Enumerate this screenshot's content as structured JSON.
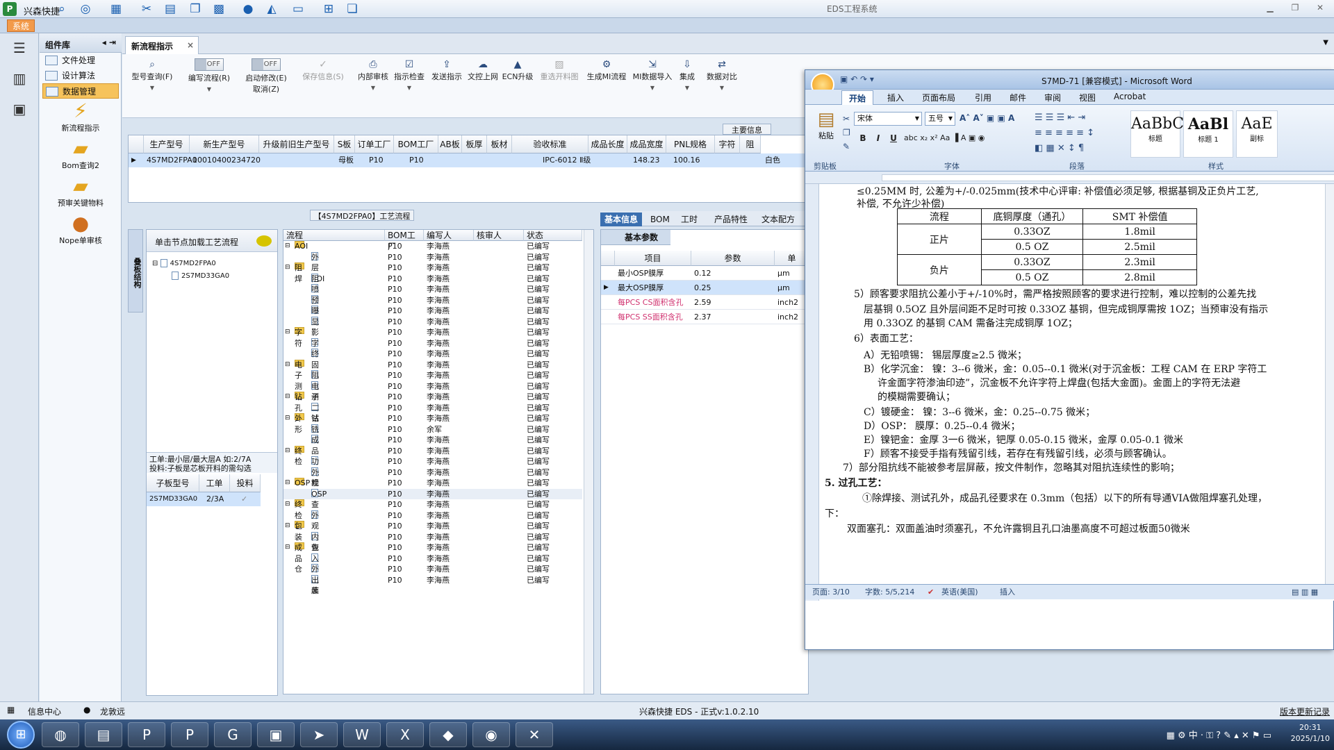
{
  "app": {
    "name": "兴森快捷",
    "window_title": "EDS工程系统",
    "sys_tab": "系统"
  },
  "sidebar": {
    "header": "组件库",
    "items": [
      "文件处理",
      "设计算法",
      "数据管理"
    ],
    "big_icons": [
      "新流程指示",
      "Bom查询2",
      "预审关键物料",
      "Nope单审核"
    ]
  },
  "main_tab": {
    "label": "新流程指示",
    "close": "×"
  },
  "ribbon": [
    {
      "label": "型号查询(F)",
      "icon": "search-icon",
      "enabled": true
    },
    {
      "label": "编写流程(R)",
      "toggle": "OFF",
      "enabled": true
    },
    {
      "label": "启动修改(E)",
      "sub": "取消(Z)",
      "toggle": "OFF",
      "enabled": true
    },
    {
      "label": "保存信息(S)",
      "icon": "check-icon",
      "enabled": false
    },
    {
      "label": "内部审核",
      "icon": "print-icon",
      "enabled": true
    },
    {
      "label": "指示检查",
      "icon": "checklist-icon",
      "enabled": true
    },
    {
      "label": "发送指示",
      "icon": "upload-icon",
      "enabled": true
    },
    {
      "label": "文控上网",
      "icon": "cloud-upload-icon",
      "enabled": true
    },
    {
      "label": "ECN升级",
      "icon": "triangle-icon",
      "enabled": true
    },
    {
      "label": "重选开料图",
      "icon": "image-icon",
      "enabled": false
    },
    {
      "label": "生成MI流程",
      "icon": "cogs-icon",
      "enabled": true
    },
    {
      "label": "MI数据导入",
      "icon": "import-icon",
      "enabled": true
    },
    {
      "label": "集成",
      "icon": "download-icon",
      "enabled": true
    },
    {
      "label": "数据对比",
      "icon": "compare-icon",
      "enabled": true
    }
  ],
  "main_grid": {
    "title": "主要信息",
    "columns": [
      "生产型号",
      "新生产型号",
      "升级前旧生产型号",
      "S板",
      "订单工厂",
      "BOM工厂",
      "AB板",
      "板厚",
      "板材",
      "验收标准",
      "成品长度",
      "成品宽度",
      "PNL规格",
      "字符",
      "阻"
    ],
    "rows": [
      [
        "4S7MD2FPA0",
        "10010400234720",
        "",
        "母板",
        "P10",
        "P10",
        "",
        "",
        "",
        "IPC-6012 Ⅱ级",
        "148.23",
        "100.16",
        "",
        "白色",
        ""
      ]
    ]
  },
  "tree_panel": {
    "title": "【4S7MD2FPA0】工艺流程",
    "vertical_tab": "叠板结构",
    "load_hint": "单击节点加载工艺流程",
    "nodes": [
      "4S7MD2FPA0",
      "2S7MD33GA0"
    ],
    "info": "工单:最小层/最大层A 如:2/7A\n投料:子板是芯板开料的需勾选",
    "sub_columns": [
      "子板型号",
      "工单",
      "投料"
    ],
    "sub_row": [
      "2S7MD33GA0",
      "2/3A",
      "✓"
    ]
  },
  "process": {
    "columns": [
      "流程",
      "BOM工厂",
      "编写人",
      "核审人",
      "状态"
    ],
    "rows": [
      {
        "name": "AOI",
        "type": "folder",
        "factory": "P10",
        "writer": "李海燕",
        "status": "已编写"
      },
      {
        "name": "外层AOI",
        "type": "doc",
        "factory": "P10",
        "writer": "李海燕",
        "status": "已编写"
      },
      {
        "name": "阻焊",
        "type": "folder",
        "factory": "P10",
        "writer": "李海燕",
        "status": "已编写"
      },
      {
        "name": "阻焊前处理",
        "type": "doc",
        "factory": "P10",
        "writer": "李海燕",
        "status": "已编写"
      },
      {
        "name": "喷涂",
        "type": "doc",
        "factory": "P10",
        "writer": "李海燕",
        "status": "已编写"
      },
      {
        "name": "预烘",
        "type": "doc",
        "factory": "P10",
        "writer": "李海燕",
        "status": "已编写"
      },
      {
        "name": "曝光",
        "type": "doc",
        "factory": "P10",
        "writer": "李海燕",
        "status": "已编写"
      },
      {
        "name": "显影",
        "type": "doc",
        "factory": "P10",
        "writer": "李海燕",
        "status": "已编写"
      },
      {
        "name": "字符",
        "type": "folder",
        "factory": "P10",
        "writer": "李海燕",
        "status": "已编写"
      },
      {
        "name": "字符",
        "type": "doc",
        "factory": "P10",
        "writer": "李海燕",
        "status": "已编写"
      },
      {
        "name": "终固化",
        "type": "doc",
        "factory": "P10",
        "writer": "李海燕",
        "status": "已编写"
      },
      {
        "name": "电子测试",
        "type": "folder",
        "factory": "P10",
        "writer": "李海燕",
        "status": "已编写"
      },
      {
        "name": "阻抗测试",
        "type": "doc",
        "factory": "P10",
        "writer": "李海燕",
        "status": "已编写"
      },
      {
        "name": "电子测试",
        "type": "doc",
        "factory": "P10",
        "writer": "李海燕",
        "status": "已编写"
      },
      {
        "name": "钻孔1",
        "type": "folder",
        "factory": "P10",
        "writer": "李海燕",
        "status": "已编写"
      },
      {
        "name": "二钻",
        "type": "doc",
        "factory": "P10",
        "writer": "李海燕",
        "status": "已编写"
      },
      {
        "name": "外形",
        "type": "folder",
        "factory": "P10",
        "writer": "李海燕",
        "status": "已编写"
      },
      {
        "name": "铣板",
        "type": "doc",
        "factory": "P10",
        "writer": "余军",
        "status": "已编写"
      },
      {
        "name": "成品清洗",
        "type": "doc",
        "factory": "P10",
        "writer": "李海燕",
        "status": "已编写"
      },
      {
        "name": "终检",
        "type": "folder",
        "factory": "P10",
        "writer": "李海燕",
        "status": "已编写"
      },
      {
        "name": "功能检查",
        "type": "doc",
        "factory": "P10",
        "writer": "李海燕",
        "status": "已编写"
      },
      {
        "name": "外观检查",
        "type": "doc",
        "factory": "P10",
        "writer": "李海燕",
        "status": "已编写"
      },
      {
        "name": "OSP",
        "type": "folder",
        "factory": "P10",
        "writer": "李海燕",
        "status": "已编写"
      },
      {
        "name": "OSP",
        "type": "doc",
        "factory": "P10",
        "writer": "李海燕",
        "status": "已编写",
        "selected": true
      },
      {
        "name": "终检1",
        "type": "folder",
        "factory": "P10",
        "writer": "李海燕",
        "status": "已编写"
      },
      {
        "name": "外观检查1",
        "type": "doc",
        "factory": "P10",
        "writer": "李海燕",
        "status": "已编写"
      },
      {
        "name": "包装",
        "type": "folder",
        "factory": "P10",
        "writer": "李海燕",
        "status": "已编写"
      },
      {
        "name": "内包装",
        "type": "doc",
        "factory": "P10",
        "writer": "李海燕",
        "status": "已编写"
      },
      {
        "name": "成品仓",
        "type": "folder",
        "factory": "P10",
        "writer": "李海燕",
        "status": "已编写"
      },
      {
        "name": "入库",
        "type": "doc",
        "factory": "P10",
        "writer": "李海燕",
        "status": "已编写"
      },
      {
        "name": "外包装",
        "type": "doc",
        "factory": "P10",
        "writer": "李海燕",
        "status": "已编写"
      },
      {
        "name": "出库",
        "type": "doc",
        "factory": "P10",
        "writer": "李海燕",
        "status": "已编写"
      }
    ]
  },
  "right_tabs": [
    "基本信息",
    "BOM",
    "工时",
    "产品特性",
    "文本配方"
  ],
  "params": {
    "tab": "基本参数",
    "columns": [
      "项目",
      "参数",
      "单"
    ],
    "rows": [
      {
        "item": "最小OSP膜厚",
        "value": "0.12",
        "unit": "μm",
        "color": "normal"
      },
      {
        "item": "最大OSP膜厚",
        "value": "0.25",
        "unit": "μm",
        "color": "normal",
        "selected": true
      },
      {
        "item": "每PCS CS面积含孔",
        "value": "2.59",
        "unit": "inch2",
        "color": "red"
      },
      {
        "item": "每PCS SS面积含孔",
        "value": "2.37",
        "unit": "inch2",
        "color": "red"
      }
    ]
  },
  "status": {
    "left": "信息中心",
    "user": "龙敦远",
    "center": "兴森快捷 EDS - 正式v:1.0.2.10",
    "right": "版本更新记录"
  },
  "taskbar": {
    "time": "20:31",
    "date": "2025/1/10"
  },
  "word": {
    "title": "S7MD-71 [兼容模式] - Microsoft Word",
    "tabs": [
      "开始",
      "插入",
      "页面布局",
      "引用",
      "邮件",
      "审阅",
      "视图",
      "Acrobat"
    ],
    "groups": [
      "剪贴板",
      "字体",
      "段落",
      "样式"
    ],
    "paste": "粘贴",
    "font": "宋体",
    "size": "五号",
    "styles": [
      {
        "sample": "AaBbC",
        "name": "标题"
      },
      {
        "sample": "AaBl",
        "name": "标题 1"
      },
      {
        "sample": "AaE",
        "name": "副标"
      }
    ],
    "status": {
      "page": "页面: 3/10",
      "words": "字数: 5/5,214",
      "lang": "英语(美国)",
      "mode": "插入"
    },
    "table": {
      "headers": [
        "流程",
        "底铜厚度（通孔）",
        "SMT 补偿值"
      ],
      "rows": [
        [
          "正片",
          "0.33OZ",
          "1.8mil"
        ],
        [
          "",
          "0.5 OZ",
          "2.5mil"
        ],
        [
          "负片",
          "0.33OZ",
          "2.3mil"
        ],
        [
          "",
          "0.5 OZ",
          "2.8mil"
        ]
      ]
    },
    "lines": [
      "≤0.25MM 时, 公差为+/-0.025mm(技术中心评审: 补偿值必须足够, 根据基铜及正负片工艺,",
      "补偿, 不允许少补偿)",
      "5）顾客要求阻抗公差小于+/-10%时，需严格按照顾客的要求进行控制，难以控制的公差先找",
      "层基铜 0.5OZ 且外层间距不足时可按 0.33OZ 基铜，但完成铜厚需按 1OZ；当预审没有指示",
      "用 0.33OZ 的基铜 CAM 需备注完成铜厚 1OZ；",
      "6）表面工艺：",
      "A）无铅喷锡： 锡层厚度≥2.5 微米；",
      "B）化学沉金： 镍：3--6 微米，金：0.05--0.1 微米(对于沉金板：工程 CAM 在 ERP 字符工",
      "许金面字符渗油印迹”，沉金板不允许字符上焊盘(包括大金面)。金面上的字符无法避",
      "的模糊需要确认；",
      "C）镀硬金：    镍：3--6 微米，金：0.25--0.75 微米；",
      "D）OSP：       膜厚：0.25--0.4 微米；",
      "E）镍钯金：金厚 3一6 微米，钯厚 0.05-0.15 微米，金厚 0.05-0.1 微米",
      "F）顾客不接受手指有残留引线，若存在有残留引线，必须与顾客确认。",
      "7）部分阻抗线不能被参考层屏蔽，按文件制作，忽略其对阻抗连续性的影响；",
      "5.  过孔工艺：",
      "①除焊接、测试孔外，成品孔径要求在 0.3mm（包括）以下的所有导通VIA做阻焊塞孔处理，",
      "下：",
      "双面塞孔：双面盖油时须塞孔，不允许露铜且孔口油墨高度不可超过板面50微米"
    ]
  }
}
